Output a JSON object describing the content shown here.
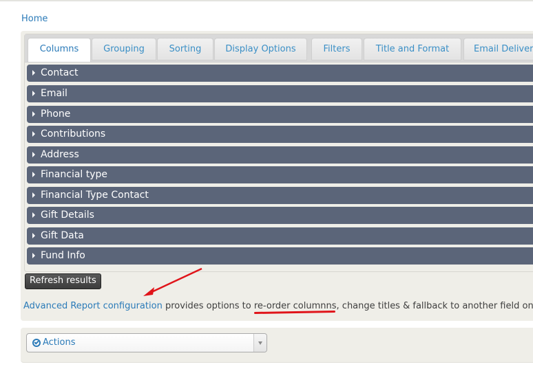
{
  "breadcrumb": {
    "home": "Home"
  },
  "tabs": [
    {
      "label": "Columns",
      "active": true
    },
    {
      "label": "Grouping",
      "active": false
    },
    {
      "label": "Sorting",
      "active": false
    },
    {
      "label": "Display Options",
      "active": false
    },
    {
      "label": "Filters",
      "active": false
    },
    {
      "label": "Title and Format",
      "active": false
    },
    {
      "label": "Email Delivery",
      "active": false
    }
  ],
  "sections": [
    {
      "label": "Contact"
    },
    {
      "label": "Email"
    },
    {
      "label": "Phone"
    },
    {
      "label": "Contributions"
    },
    {
      "label": "Address"
    },
    {
      "label": "Financial type"
    },
    {
      "label": "Financial Type Contact"
    },
    {
      "label": "Gift Details"
    },
    {
      "label": "Gift Data"
    },
    {
      "label": "Fund Info"
    }
  ],
  "refresh_label": "Refresh results",
  "note": {
    "link": "Advanced Report configuration",
    "text1": " provides options to ",
    "highlight": "re-order columnns",
    "text2": ", change titles & fallback to another field on"
  },
  "actions": {
    "label": "Actions",
    "icon": "check-circle-icon"
  },
  "colors": {
    "accent": "#2a7ab8",
    "section_bg": "#5b6579",
    "annotation": "#e0141a"
  }
}
